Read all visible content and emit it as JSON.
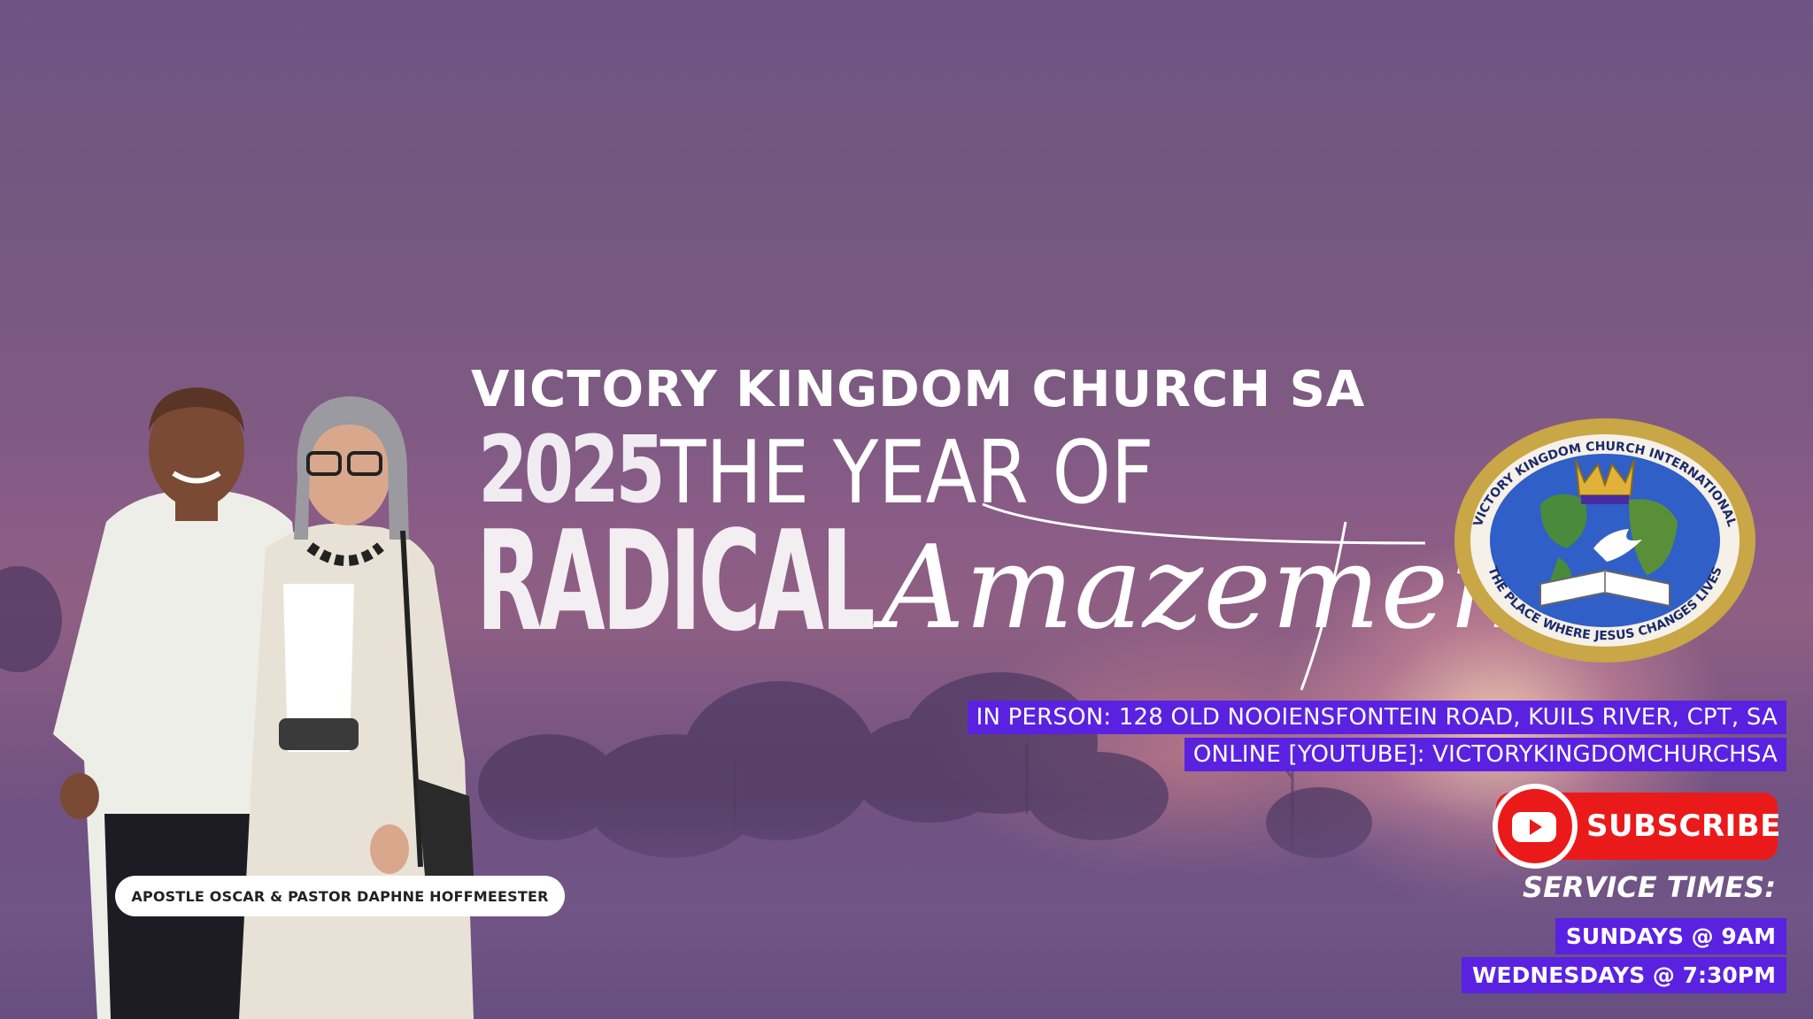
{
  "banner": {
    "church_name": "VICTORY KINGDOM CHURCH SA",
    "year": "2025",
    "year_of": "THE YEAR OF",
    "radical": "RADICAL",
    "amazement": "Amazement"
  },
  "logo": {
    "ring_top_text": "VICTORY KINGDOM CHURCH INTERNATIONAL",
    "ring_bottom_text": "THE PLACE WHERE JESUS CHANGES LIVES",
    "ring_color": "#c9a646"
  },
  "locations": {
    "in_person": "IN PERSON: 128 OLD NOOIENSFONTEIN ROAD, KUILS RIVER, CPT, SA",
    "online": "ONLINE [YOUTUBE]: VICTORYKINGDOMCHURCHSA"
  },
  "subscribe": {
    "label": "SUBSCRIBE",
    "icon": "youtube-play-icon",
    "color": "#ea1a1a"
  },
  "service": {
    "title": "SERVICE TIMES:",
    "times": [
      "SUNDAYS @  9AM",
      "WEDNESDAYS @ 7:30PM"
    ]
  },
  "caption": "APOSTLE OSCAR & PASTOR DAPHNE HOFFMEESTER",
  "colors": {
    "accent_purple": "#5a22e0",
    "text": "#ffffff"
  }
}
